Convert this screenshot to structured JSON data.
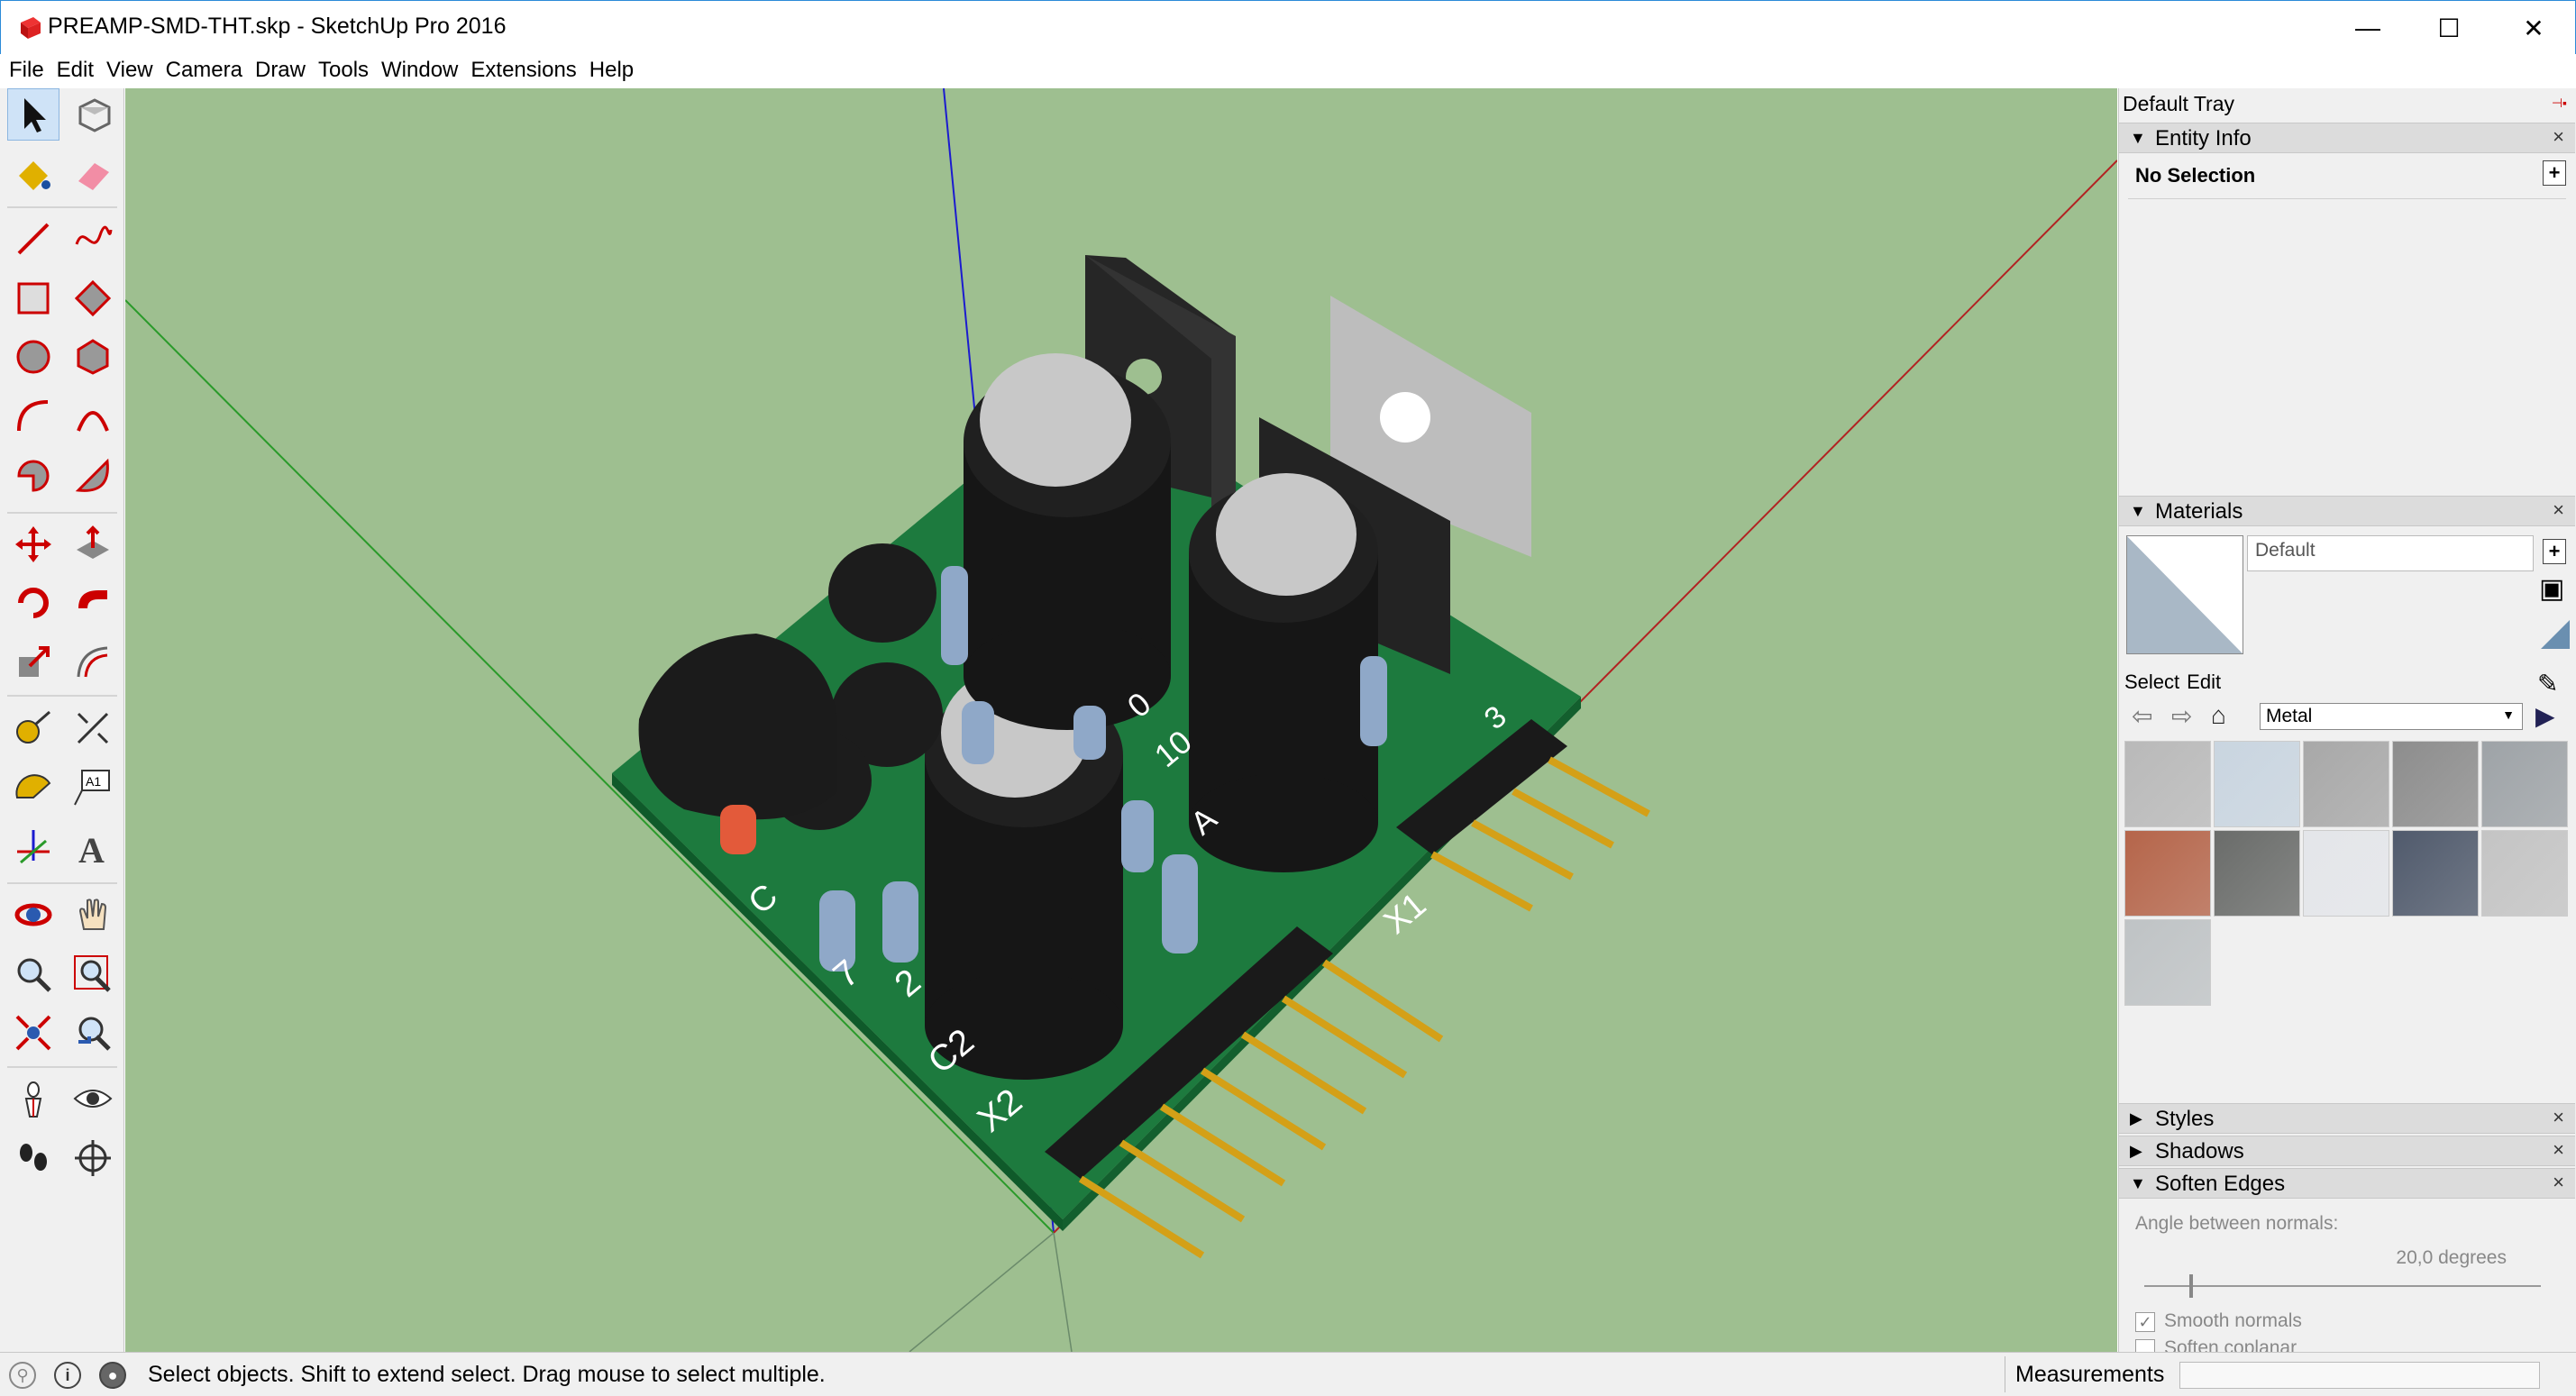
{
  "window": {
    "title": "PREAMP-SMD-THT.skp - SketchUp Pro 2016",
    "minimize": "—",
    "maximize": "☐",
    "close": "✕"
  },
  "menu": [
    "File",
    "Edit",
    "View",
    "Camera",
    "Draw",
    "Tools",
    "Window",
    "Extensions",
    "Help"
  ],
  "toolbar": {
    "tools": [
      "select",
      "make-component",
      "paint-bucket",
      "eraser",
      "line",
      "freehand",
      "rectangle",
      "rotated-rectangle",
      "circle",
      "polygon",
      "arc",
      "arc-3pt",
      "pie",
      "arc-2pt",
      "move",
      "push-pull",
      "rotate",
      "follow-me",
      "scale",
      "offset",
      "tape-measure",
      "dimension",
      "protractor",
      "text",
      "axes",
      "3d-text",
      "orbit",
      "pan",
      "zoom",
      "zoom-window",
      "zoom-extents",
      "previous-view",
      "position-camera",
      "look-around",
      "walk",
      "section-plane"
    ],
    "active": "select"
  },
  "viewport": {
    "background": "#9ebf90",
    "labels": {
      "c1": "C",
      "r7": "7",
      "r2": "2",
      "c2": "C2",
      "x2": "X2",
      "x1": "X1",
      "pad3": "3",
      "c0": "0",
      "c10": "10",
      "a": "A"
    }
  },
  "tray": {
    "title": "Default Tray",
    "entity_info": {
      "label": "Entity Info",
      "selection": "No Selection"
    },
    "materials": {
      "label": "Materials",
      "current": "Default",
      "tab_select": "Select",
      "tab_edit": "Edit",
      "library": "Metal",
      "swatch_colors": [
        "#b9b9b9",
        "#c9d5e0",
        "#a8a8a8",
        "#8d8d8d",
        "#9ea3a7",
        "#b5654a",
        "#6a6c6a",
        "#e4e6ea",
        "#505a6c",
        "#c4c4c4",
        "#bfc3c5"
      ]
    },
    "styles": {
      "label": "Styles"
    },
    "shadows": {
      "label": "Shadows"
    },
    "soften_edges": {
      "label": "Soften Edges",
      "angle_label": "Angle between normals:",
      "angle_value": "20,0  degrees",
      "smooth_normals": "Smooth normals",
      "soften_coplanar": "Soften coplanar",
      "smooth_normals_checked": true,
      "soften_coplanar_checked": false
    }
  },
  "statusbar": {
    "message": "Select objects. Shift to extend select. Drag mouse to select multiple.",
    "measurements_label": "Measurements",
    "measurements_value": ""
  }
}
